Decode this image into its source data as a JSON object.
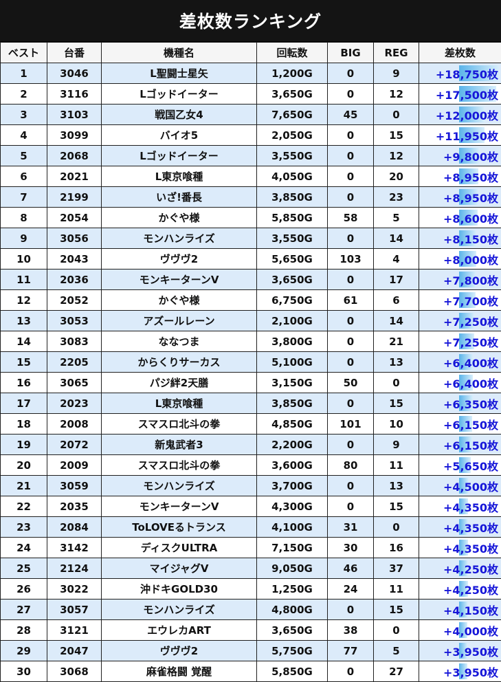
{
  "title": "差枚数ランキング",
  "headers": {
    "rank": "ベスト",
    "unit": "台番",
    "model": "機種名",
    "spins": "回転数",
    "big": "BIG",
    "reg": "REG",
    "diff": "差枚数"
  },
  "bar_color": "#5ab4ea",
  "diff_color": "#1616d8",
  "rows": [
    {
      "rank": "1",
      "unit": "3046",
      "model": "L聖闘士星矢",
      "spins": "1,200G",
      "big": "0",
      "reg": "9",
      "diff": "+18,750枚",
      "diff_value": 18750
    },
    {
      "rank": "2",
      "unit": "3116",
      "model": "Lゴッドイーター",
      "spins": "3,650G",
      "big": "0",
      "reg": "12",
      "diff": "+17,500枚",
      "diff_value": 17500
    },
    {
      "rank": "3",
      "unit": "3103",
      "model": "戦国乙女4",
      "spins": "7,650G",
      "big": "45",
      "reg": "0",
      "diff": "+12,000枚",
      "diff_value": 12000
    },
    {
      "rank": "4",
      "unit": "3099",
      "model": "バイオ5",
      "spins": "2,050G",
      "big": "0",
      "reg": "15",
      "diff": "+11,950枚",
      "diff_value": 11950
    },
    {
      "rank": "5",
      "unit": "2068",
      "model": "Lゴッドイーター",
      "spins": "3,550G",
      "big": "0",
      "reg": "12",
      "diff": "+9,800枚",
      "diff_value": 9800
    },
    {
      "rank": "6",
      "unit": "2021",
      "model": "L東京喰種",
      "spins": "4,050G",
      "big": "0",
      "reg": "20",
      "diff": "+8,950枚",
      "diff_value": 8950
    },
    {
      "rank": "7",
      "unit": "2199",
      "model": "いざ!番長",
      "spins": "3,850G",
      "big": "0",
      "reg": "23",
      "diff": "+8,950枚",
      "diff_value": 8950
    },
    {
      "rank": "8",
      "unit": "2054",
      "model": "かぐや様",
      "spins": "5,850G",
      "big": "58",
      "reg": "5",
      "diff": "+8,600枚",
      "diff_value": 8600
    },
    {
      "rank": "9",
      "unit": "3056",
      "model": "モンハンライズ",
      "spins": "3,550G",
      "big": "0",
      "reg": "14",
      "diff": "+8,150枚",
      "diff_value": 8150
    },
    {
      "rank": "10",
      "unit": "2043",
      "model": "ヴヴヴ2",
      "spins": "5,650G",
      "big": "103",
      "reg": "4",
      "diff": "+8,000枚",
      "diff_value": 8000
    },
    {
      "rank": "11",
      "unit": "2036",
      "model": "モンキーターンV",
      "spins": "3,650G",
      "big": "0",
      "reg": "17",
      "diff": "+7,800枚",
      "diff_value": 7800
    },
    {
      "rank": "12",
      "unit": "2052",
      "model": "かぐや様",
      "spins": "6,750G",
      "big": "61",
      "reg": "6",
      "diff": "+7,700枚",
      "diff_value": 7700
    },
    {
      "rank": "13",
      "unit": "3053",
      "model": "アズールレーン",
      "spins": "2,100G",
      "big": "0",
      "reg": "14",
      "diff": "+7,250枚",
      "diff_value": 7250
    },
    {
      "rank": "14",
      "unit": "3083",
      "model": "ななつま",
      "spins": "3,800G",
      "big": "0",
      "reg": "21",
      "diff": "+7,250枚",
      "diff_value": 7250
    },
    {
      "rank": "15",
      "unit": "2205",
      "model": "からくりサーカス",
      "spins": "5,100G",
      "big": "0",
      "reg": "13",
      "diff": "+6,400枚",
      "diff_value": 6400
    },
    {
      "rank": "16",
      "unit": "3065",
      "model": "パジ絆2天膳",
      "spins": "3,150G",
      "big": "50",
      "reg": "0",
      "diff": "+6,400枚",
      "diff_value": 6400
    },
    {
      "rank": "17",
      "unit": "2023",
      "model": "L東京喰種",
      "spins": "3,850G",
      "big": "0",
      "reg": "15",
      "diff": "+6,350枚",
      "diff_value": 6350
    },
    {
      "rank": "18",
      "unit": "2008",
      "model": "スマスロ北斗の拳",
      "spins": "4,850G",
      "big": "101",
      "reg": "10",
      "diff": "+6,150枚",
      "diff_value": 6150
    },
    {
      "rank": "19",
      "unit": "2072",
      "model": "新鬼武者3",
      "spins": "2,200G",
      "big": "0",
      "reg": "9",
      "diff": "+6,150枚",
      "diff_value": 6150
    },
    {
      "rank": "20",
      "unit": "2009",
      "model": "スマスロ北斗の拳",
      "spins": "3,600G",
      "big": "80",
      "reg": "11",
      "diff": "+5,650枚",
      "diff_value": 5650
    },
    {
      "rank": "21",
      "unit": "3059",
      "model": "モンハンライズ",
      "spins": "3,700G",
      "big": "0",
      "reg": "13",
      "diff": "+4,500枚",
      "diff_value": 4500
    },
    {
      "rank": "22",
      "unit": "2035",
      "model": "モンキーターンV",
      "spins": "4,300G",
      "big": "0",
      "reg": "15",
      "diff": "+4,350枚",
      "diff_value": 4350
    },
    {
      "rank": "23",
      "unit": "2084",
      "model": "ToLOVEるトランス",
      "spins": "4,100G",
      "big": "31",
      "reg": "0",
      "diff": "+4,350枚",
      "diff_value": 4350
    },
    {
      "rank": "24",
      "unit": "3142",
      "model": "ディスクULTRA",
      "spins": "7,150G",
      "big": "30",
      "reg": "16",
      "diff": "+4,350枚",
      "diff_value": 4350
    },
    {
      "rank": "25",
      "unit": "2124",
      "model": "マイジャグV",
      "spins": "9,050G",
      "big": "46",
      "reg": "37",
      "diff": "+4,250枚",
      "diff_value": 4250
    },
    {
      "rank": "26",
      "unit": "3022",
      "model": "沖ドキGOLD30",
      "spins": "1,250G",
      "big": "24",
      "reg": "11",
      "diff": "+4,250枚",
      "diff_value": 4250
    },
    {
      "rank": "27",
      "unit": "3057",
      "model": "モンハンライズ",
      "spins": "4,800G",
      "big": "0",
      "reg": "15",
      "diff": "+4,150枚",
      "diff_value": 4150
    },
    {
      "rank": "28",
      "unit": "3121",
      "model": "エウレカART",
      "spins": "3,650G",
      "big": "38",
      "reg": "0",
      "diff": "+4,000枚",
      "diff_value": 4000
    },
    {
      "rank": "29",
      "unit": "2047",
      "model": "ヴヴヴ2",
      "spins": "5,750G",
      "big": "77",
      "reg": "5",
      "diff": "+3,950枚",
      "diff_value": 3950
    },
    {
      "rank": "30",
      "unit": "3068",
      "model": "麻雀格闘 覚醒",
      "spins": "5,850G",
      "big": "0",
      "reg": "27",
      "diff": "+3,950枚",
      "diff_value": 3950
    }
  ]
}
